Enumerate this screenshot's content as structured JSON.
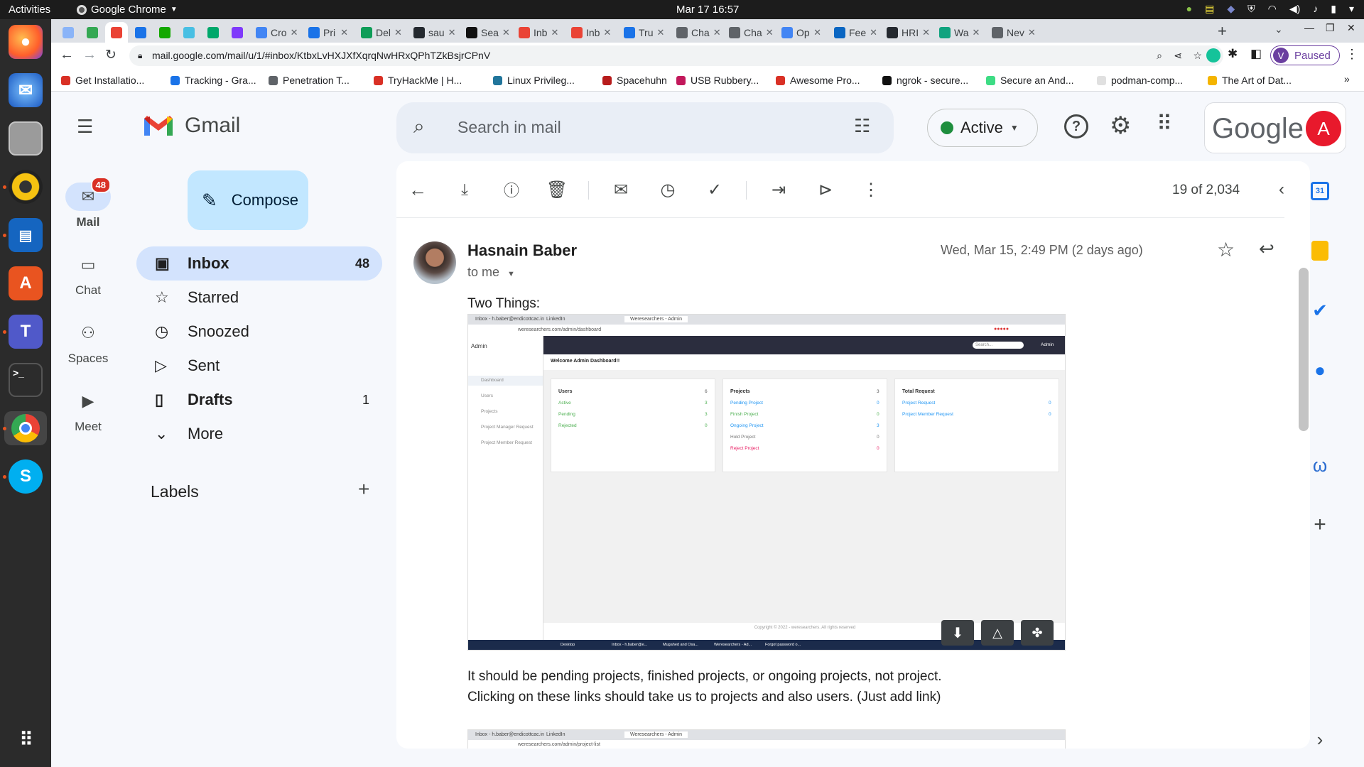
{
  "os": {
    "activities": "Activities",
    "app_name": "Google Chrome",
    "clock": "Mar 17  16:57"
  },
  "tabs": [
    {
      "label": "",
      "color": "#8ab4f8"
    },
    {
      "label": "",
      "color": "#34a853"
    },
    {
      "label": "",
      "color": "#ea4335",
      "active": true
    },
    {
      "label": "",
      "color": "#1a73e8"
    },
    {
      "label": "",
      "color": "#14a800"
    },
    {
      "label": "",
      "color": "#48bfe3"
    },
    {
      "label": "",
      "color": "#00a86b"
    },
    {
      "label": "",
      "color": "#7f39fb"
    },
    {
      "label": "Cro",
      "color": "#4285f4"
    },
    {
      "label": "Pri",
      "color": "#1a73e8"
    },
    {
      "label": "Del",
      "color": "#0f9d58"
    },
    {
      "label": "sau",
      "color": "#24292f"
    },
    {
      "label": "Sea",
      "color": "#111"
    },
    {
      "label": "Inb",
      "color": "#ea4335"
    },
    {
      "label": "Inb",
      "color": "#ea4335"
    },
    {
      "label": "Tru",
      "color": "#1a73e8"
    },
    {
      "label": "Cha",
      "color": "#5f6368"
    },
    {
      "label": "Cha",
      "color": "#5f6368"
    },
    {
      "label": "Op",
      "color": "#4285f4"
    },
    {
      "label": "Fee",
      "color": "#0a66c2"
    },
    {
      "label": "HRI",
      "color": "#24292f"
    },
    {
      "label": "Wa",
      "color": "#10a37f"
    },
    {
      "label": "Nev",
      "color": "#5f6368"
    }
  ],
  "url": "mail.google.com/mail/u/1/#inbox/KtbxLvHXJXfXqrqNwHRxQPhTZkBsjrCPnV",
  "profile_status": "Paused",
  "profile_initial": "V",
  "bookmarks": [
    {
      "label": "Get Installatio...",
      "color": "#d93025"
    },
    {
      "label": "Tracking - Gra...",
      "color": "#1a73e8"
    },
    {
      "label": "Penetration T...",
      "color": "#5f6368"
    },
    {
      "label": "TryHackMe | H...",
      "color": "#d93025"
    },
    {
      "label": "Linux Privileg...",
      "color": "#21759b"
    },
    {
      "label": "Spacehuhn",
      "color": "#b71c1c"
    },
    {
      "label": "USB Rubbery...",
      "color": "#c2185b"
    },
    {
      "label": "Awesome Pro...",
      "color": "#d93025"
    },
    {
      "label": "ngrok - secure...",
      "color": "#111"
    },
    {
      "label": "Secure an And...",
      "color": "#3ddc84"
    },
    {
      "label": "podman-comp...",
      "color": "#e0e0e0"
    },
    {
      "label": "The Art of Dat...",
      "color": "#f4b400"
    }
  ],
  "gmail": {
    "logo_text": "Gmail",
    "search_placeholder": "Search in mail",
    "status": "Active",
    "google_text": "Google",
    "account_initial": "A",
    "rail": [
      {
        "label": "Mail",
        "badge": "48"
      },
      {
        "label": "Chat"
      },
      {
        "label": "Spaces"
      },
      {
        "label": "Meet"
      }
    ],
    "compose": "Compose",
    "nav": [
      {
        "label": "Inbox",
        "count": "48"
      },
      {
        "label": "Starred",
        "count": ""
      },
      {
        "label": "Snoozed",
        "count": ""
      },
      {
        "label": "Sent",
        "count": ""
      },
      {
        "label": "Drafts",
        "count": "1"
      },
      {
        "label": "More",
        "count": ""
      }
    ],
    "labels_heading": "Labels",
    "pagination": "19 of 2,034",
    "message": {
      "sender": "Hasnain Baber",
      "recipient": "to me",
      "date": "Wed, Mar 15, 2:49 PM (2 days ago)",
      "intro": "Two Things:",
      "body_line1": "It should be pending projects, finished projects, or ongoing projects, not project.",
      "body_line2": "Clicking on these links should take us to projects and also users. (Just add link)"
    },
    "attachment": {
      "tab1": "Inbox - h.baber@endicottcac.in",
      "tab2": "LinkedIn",
      "tab3": "Weresearchers - Admin",
      "url": "weresearchers.com/admin/dashboard",
      "brand": "Admin",
      "search": "Search...",
      "admin": "Admin",
      "welcome": "Welcome Admin Dashboard!!",
      "menu": [
        "Dashboard",
        "Users",
        "Projects",
        "Project Manager Request",
        "Project Member Request"
      ],
      "cards": [
        {
          "title": "Users",
          "total": "6",
          "rows": [
            [
              "Active",
              "3",
              "#4caf50"
            ],
            [
              "Pending",
              "3",
              "#4caf50"
            ],
            [
              "Rejected",
              "0",
              "#4caf50"
            ]
          ]
        },
        {
          "title": "Projects",
          "total": "3",
          "rows": [
            [
              "Pending Project",
              "0",
              "#2196f3"
            ],
            [
              "Finish Project",
              "0",
              "#4caf50"
            ],
            [
              "Ongoing Project",
              "3",
              "#2196f3"
            ],
            [
              "Hold Project",
              "0",
              "#777"
            ],
            [
              "Reject Project",
              "0",
              "#e91e63"
            ]
          ]
        },
        {
          "title": "Total Request",
          "total": "",
          "rows": [
            [
              "Project Request",
              "0",
              "#2196f3"
            ],
            [
              "Project Member Request",
              "0",
              "#2196f3"
            ]
          ]
        }
      ],
      "footer": "Copyright © 2022 - weresearchers. All rights reserved",
      "taskbar": [
        "Desktop",
        "Inbox - h.baber@e...",
        "Mugahed and Osa...",
        "Weresearchers - Ad...",
        "Forgot password o..."
      ]
    },
    "attachment2": {
      "tab1": "Inbox - h.baber@endicottcac.in",
      "tab2": "LinkedIn",
      "tab3": "Weresearchers - Admin",
      "url": "weresearchers.com/admin/project-list"
    }
  }
}
